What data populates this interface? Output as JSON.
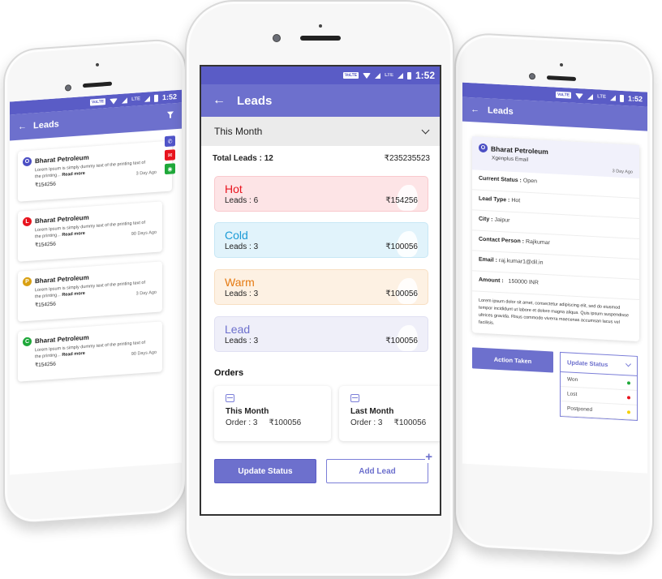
{
  "status_bar": {
    "time": "1:52",
    "volte": "VoLTE",
    "lte": "LTE"
  },
  "center": {
    "title": "Leads",
    "period_select": "This Month",
    "total_leads_label": "Total Leads : 12",
    "total_amount": "₹235235523",
    "categories": [
      {
        "name": "Hot",
        "leads": "Leads : 6",
        "amount": "₹154256",
        "color": "#e8141e",
        "bg": "#fde4e6",
        "border": "#f9c9cd"
      },
      {
        "name": "Cold",
        "leads": "Leads : 3",
        "amount": "₹100056",
        "color": "#1a9ad6",
        "bg": "#e1f3fb",
        "border": "#c7e7f5"
      },
      {
        "name": "Warm",
        "leads": "Leads : 3",
        "amount": "₹100056",
        "color": "#e57a12",
        "bg": "#fdf1e3",
        "border": "#f8dfc3"
      },
      {
        "name": "Lead",
        "leads": "Leads : 3",
        "amount": "₹100056",
        "color": "#6d70cd",
        "bg": "#efeff9",
        "border": "#e0e0f2"
      }
    ],
    "orders_title": "Orders",
    "orders": [
      {
        "title": "This Month",
        "count": "Order : 3",
        "amount": "₹100056"
      },
      {
        "title": "Last Month",
        "count": "Order : 3",
        "amount": "₹100056"
      }
    ],
    "update_status_label": "Update Status",
    "add_lead_label": "Add Lead"
  },
  "left": {
    "title": "Leads",
    "leads": [
      {
        "initial": "O",
        "badge_color": "#4b4fc4",
        "name": "Bharat Petroleum",
        "desc": "Lorem Ipsum is simply dummy text of the printing text of the printing...",
        "read_more": "Read more",
        "amount": "₹154256",
        "ago": "3 Day Ago"
      },
      {
        "initial": "L",
        "badge_color": "#e8141e",
        "name": "Bharat Petroleum",
        "desc": "Lorem Ipsum is simply dummy text of the printing text of the printing...",
        "read_more": "Read more",
        "amount": "₹154256",
        "ago": "90 Days Ago"
      },
      {
        "initial": "P",
        "badge_color": "#d9a012",
        "name": "Bharat Petroleum",
        "desc": "Lorem Ipsum is simply dummy text of the printing text of the printing...",
        "read_more": "Read more",
        "amount": "₹154256",
        "ago": "3 Day Ago"
      },
      {
        "initial": "C",
        "badge_color": "#1fa83a",
        "name": "Bharat Petroleum",
        "desc": "Lorem Ipsum is simply dummy text of the printing text of the printing...",
        "read_more": "Read more",
        "amount": "₹154256",
        "ago": "90 Days Ago"
      }
    ],
    "actions": [
      {
        "icon": "phone-icon",
        "glyph": "✆",
        "color": "#5054c8"
      },
      {
        "icon": "email-icon",
        "glyph": "✉",
        "color": "#e8141e"
      },
      {
        "icon": "whatsapp-icon",
        "glyph": "◉",
        "color": "#1fa83a"
      }
    ]
  },
  "right": {
    "title": "Leads",
    "lead": {
      "initial": "O",
      "name": "Bharat Petroleum",
      "subtitle": "Xgenplus Email",
      "ago": "3 Day Ago"
    },
    "fields": [
      {
        "label": "Current Status :",
        "value": " Open"
      },
      {
        "label": "Lead Type :",
        "value": " Hot"
      },
      {
        "label": "City :",
        "value": " Jaipur"
      },
      {
        "label": "Contact Person :",
        "value": " Rajkumar"
      },
      {
        "label": "Email :",
        "value": " raj.kumar1@dil.in"
      },
      {
        "label": "Amount :",
        "value": "   150000 INR"
      }
    ],
    "description": "Lorem ipsum dolor sit amet, consectetur adipiscing elit, sed do eiusmod tempor incididunt ut labore et dolore magna aliqua. Quis ipsum suspendisse ultrices gravida. Risus commodo viverra maecenas accumsan lacus vel facilisis.",
    "action_taken_label": "Action Taken",
    "update_status_label": "Update Status",
    "status_options": [
      {
        "label": "Won",
        "color": "#1fa83a"
      },
      {
        "label": "Lost",
        "color": "#e8141e"
      },
      {
        "label": "Postponed",
        "color": "#f5d000"
      }
    ]
  }
}
